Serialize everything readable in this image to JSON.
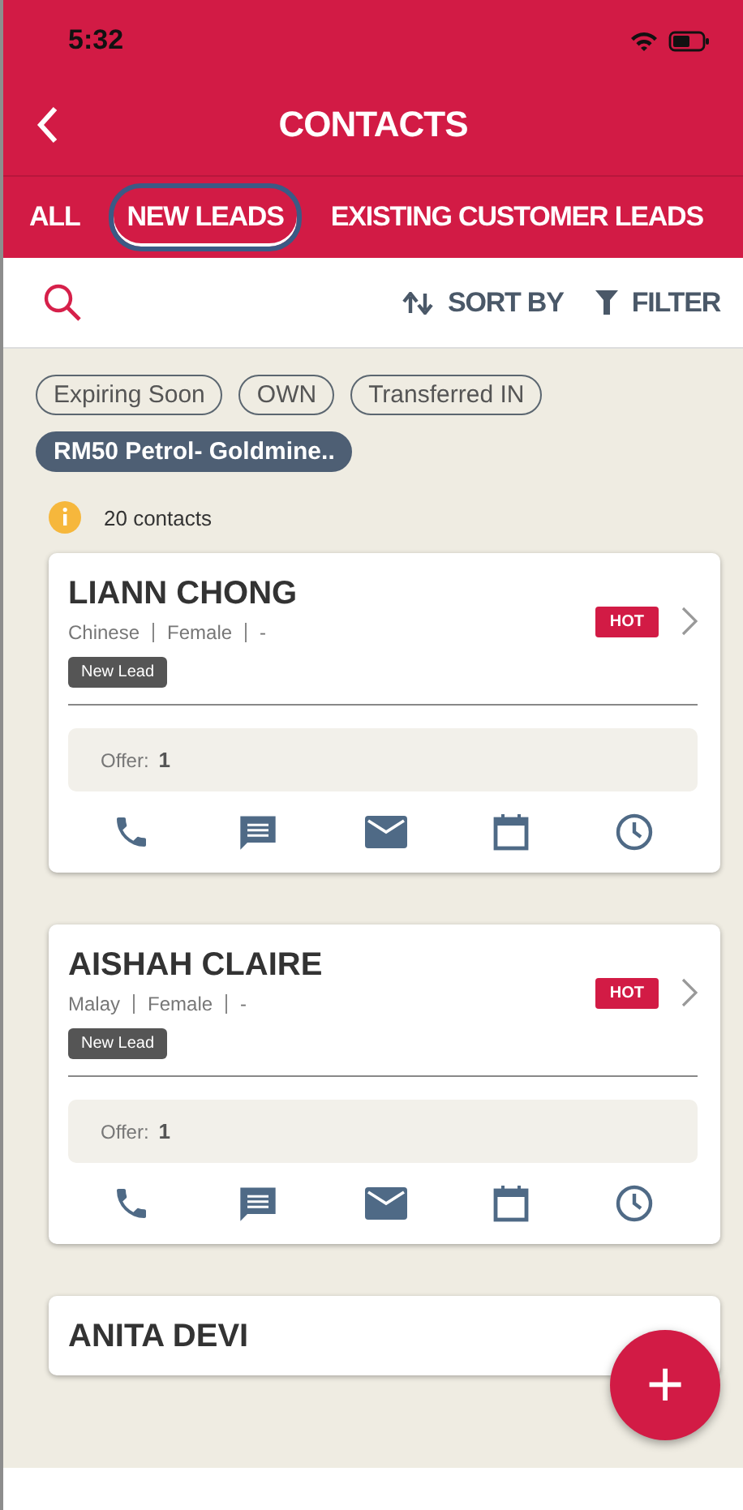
{
  "status_bar": {
    "time": "5:32"
  },
  "header": {
    "title": "CONTACTS"
  },
  "tabs": [
    {
      "label": "ALL",
      "selected": false
    },
    {
      "label": "NEW LEADS",
      "selected": true
    },
    {
      "label": "EXISTING CUSTOMER LEADS",
      "selected": false
    }
  ],
  "toolbar": {
    "sort": "SORT BY",
    "filter": "FILTER"
  },
  "chips": [
    {
      "label": "Expiring Soon",
      "selected": false
    },
    {
      "label": "OWN",
      "selected": false
    },
    {
      "label": "Transferred IN",
      "selected": false
    },
    {
      "label": "RM50 Petrol- Goldmine..",
      "selected": true
    }
  ],
  "count": "20 contacts",
  "contacts": [
    {
      "name": "LIANN CHONG",
      "details": [
        "Chinese",
        "Female",
        "-"
      ],
      "tag": "New Lead",
      "badge": "HOT",
      "offer_label": "Offer:",
      "offer_value": "1"
    },
    {
      "name": "AISHAH CLAIRE",
      "details": [
        "Malay",
        "Female",
        "-"
      ],
      "tag": "New Lead",
      "badge": "HOT",
      "offer_label": "Offer:",
      "offer_value": "1"
    },
    {
      "name": "ANITA DEVI"
    }
  ],
  "fab": "+"
}
